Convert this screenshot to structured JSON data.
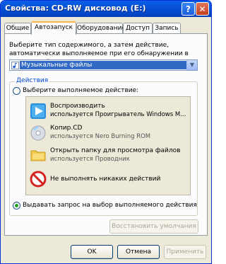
{
  "window": {
    "title": "Свойства: CD-RW дисковод (E:)",
    "help": "?",
    "close": "✕"
  },
  "tabs": [
    "Общие",
    "Автозапуск",
    "Оборудование",
    "Доступ",
    "Запись"
  ],
  "active_tab": "Автозапуск",
  "description": "Выберите тип содержимого, а затем действие, автоматически выполняемое при его обнаружении в этом устройстве:",
  "content_type": {
    "selected": "Музыкальные файлы"
  },
  "actions": {
    "legend": "Действия",
    "choose_label": "Выберите выполняемое действие:",
    "items": [
      {
        "line1": "Воспроизводить",
        "line2": "используется Проигрыватель Windows M...",
        "icon": "play-icon"
      },
      {
        "line1": "Копир.CD",
        "line2": "используется Nero Burning ROM",
        "icon": "cd-icon"
      },
      {
        "line1": "Открыть папку для просмотра файлов",
        "line2": "используется Проводник",
        "icon": "folder-icon"
      },
      {
        "line1": "Не выполнять никаких действий",
        "line2": "",
        "icon": "no-action-icon"
      }
    ],
    "prompt_label": "Выдавать запрос на выбор выполняемого действия",
    "restore_label": "Восстановить умолчания"
  },
  "buttons": {
    "ok": "OK",
    "cancel": "Отмена",
    "apply": "Применить"
  }
}
